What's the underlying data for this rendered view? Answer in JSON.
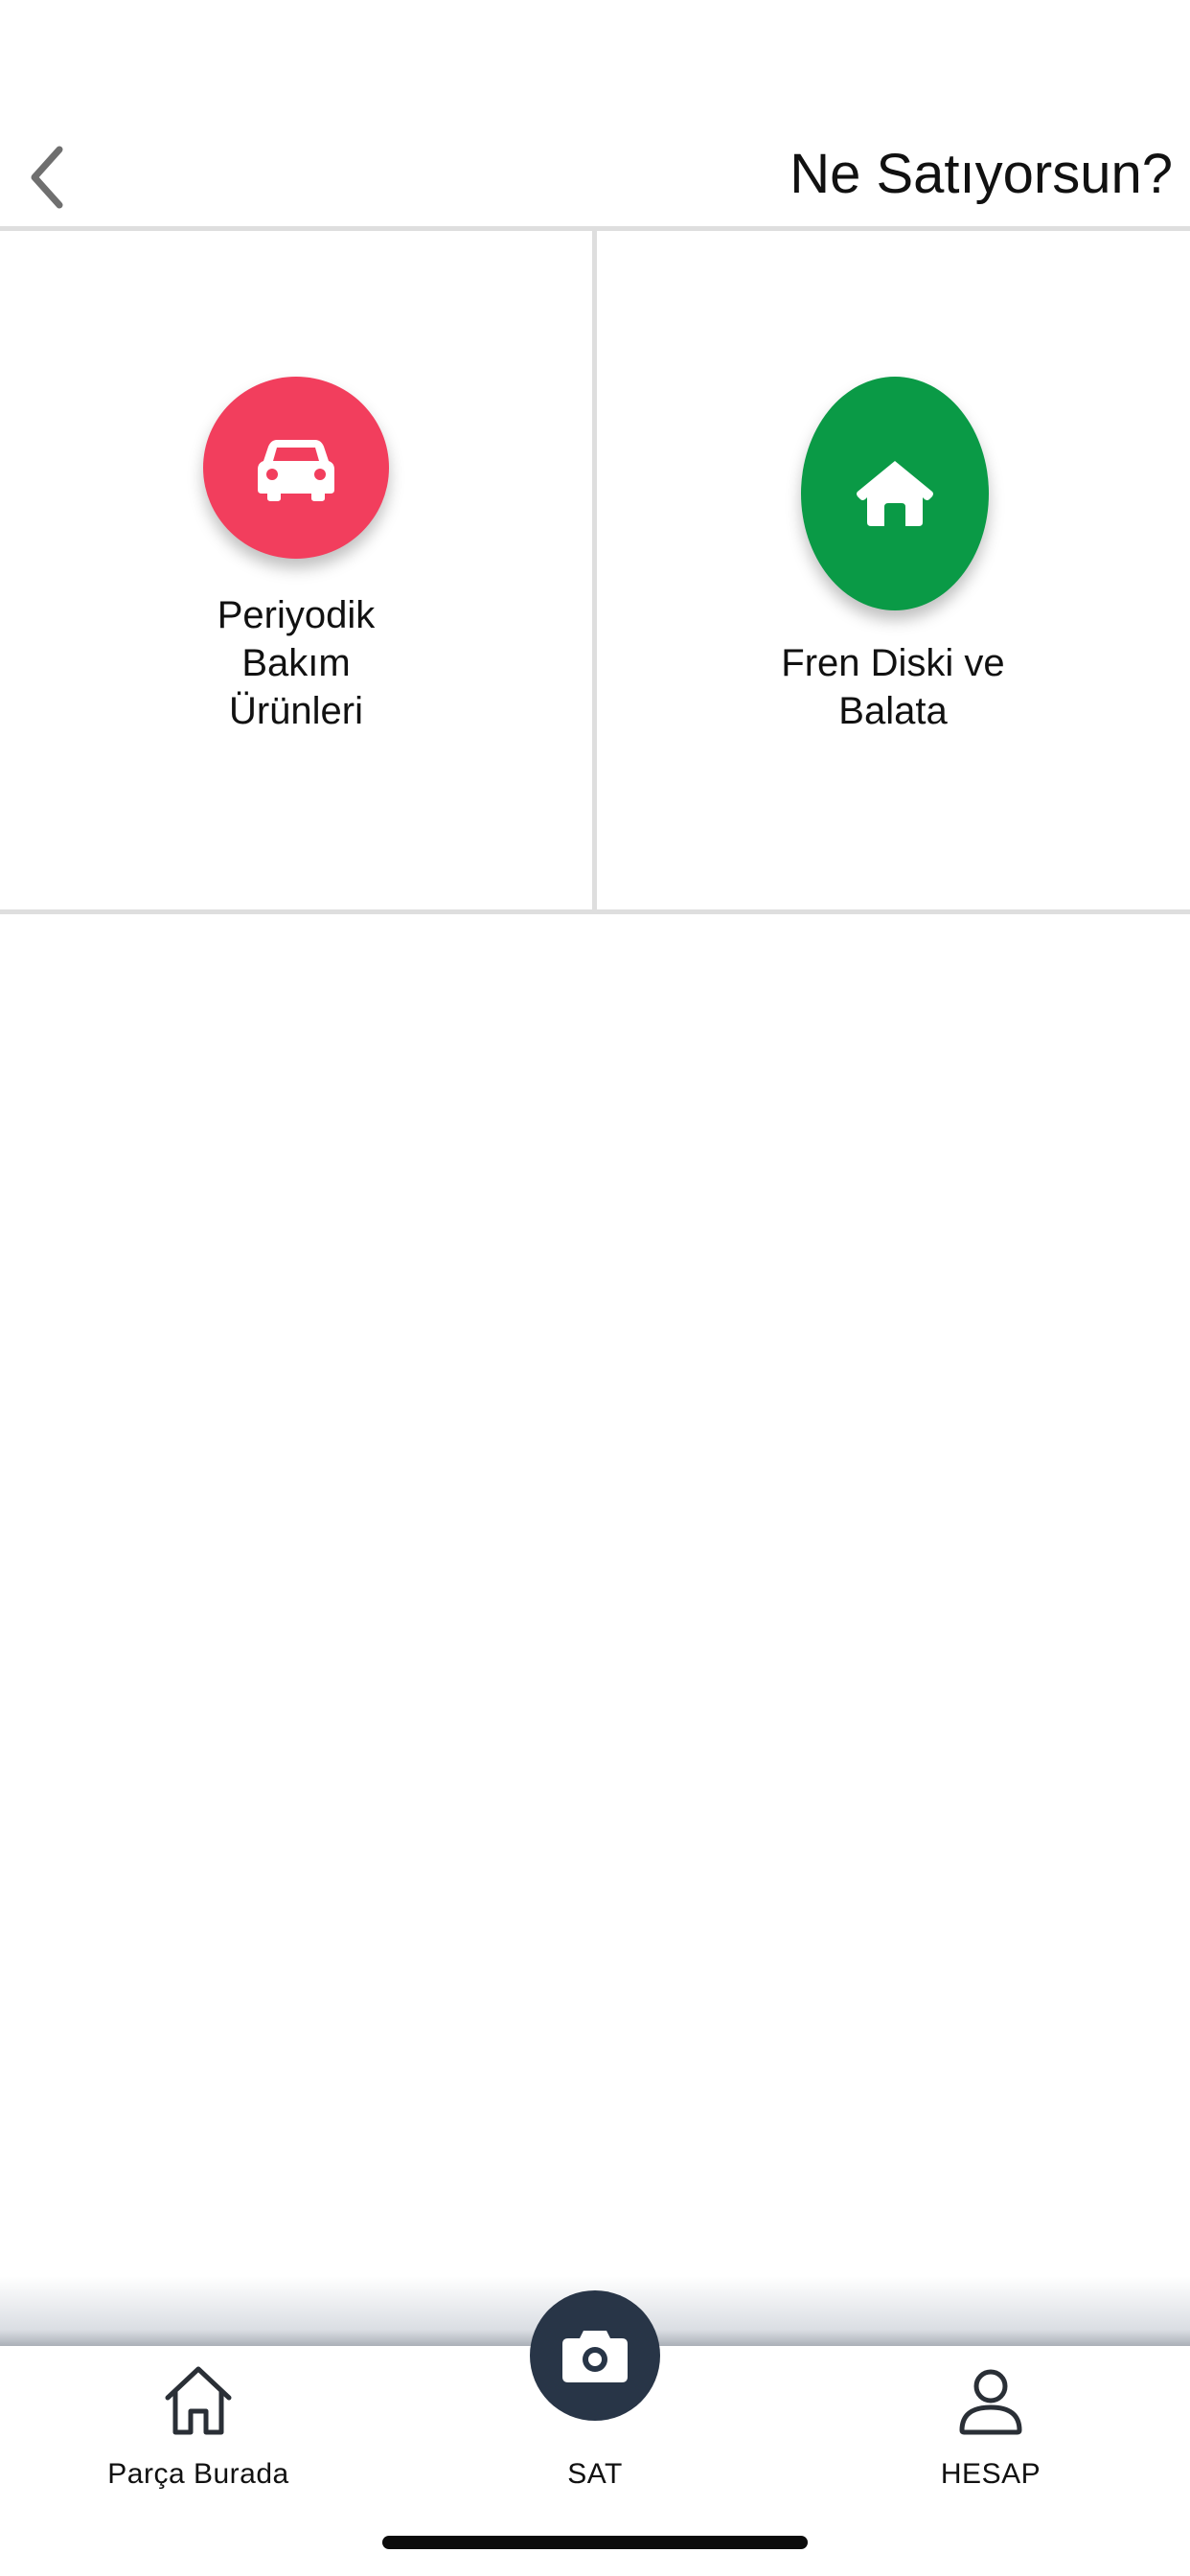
{
  "header": {
    "title": "Ne Satıyorsun?",
    "back_icon": "chevron-left-icon"
  },
  "categories": [
    {
      "label": "Periyodik\nBakım\nÜrünleri",
      "icon": "car-icon",
      "color": "#f23e5d"
    },
    {
      "label": "Fren Diski ve\nBalata",
      "icon": "home-icon",
      "color": "#0a9a46"
    }
  ],
  "tab_bar": {
    "items": [
      {
        "label": "Parça Burada",
        "icon": "home-outline-icon"
      },
      {
        "label": "SAT",
        "icon": "camera-icon"
      },
      {
        "label": "HESAP",
        "icon": "user-icon"
      }
    ],
    "sell_button_color": "#283547"
  }
}
